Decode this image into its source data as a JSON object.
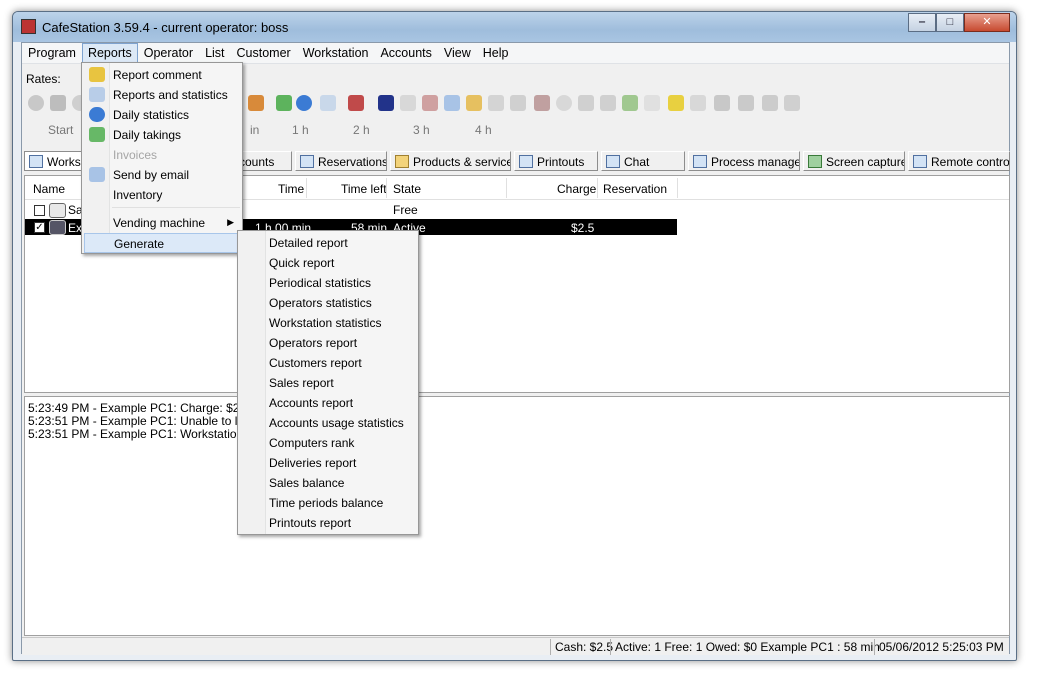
{
  "window": {
    "title": "CafeStation 3.59.4 - current operator: boss"
  },
  "menubar": [
    "Program",
    "Reports",
    "Operator",
    "List",
    "Customer",
    "Workstation",
    "Accounts",
    "View",
    "Help"
  ],
  "rates_label": "Rates:",
  "timebar": {
    "start": "Start",
    "marks": [
      "in",
      "1 h",
      "2 h",
      "3 h",
      "4 h"
    ]
  },
  "tabs": [
    {
      "label": "Works",
      "icon": "workstation-icon"
    },
    {
      "label": "ccounts",
      "icon": "accounts-icon"
    },
    {
      "label": "Reservations",
      "icon": "reservations-icon"
    },
    {
      "label": "Products & services",
      "icon": "products-icon"
    },
    {
      "label": "Printouts",
      "icon": "printer-icon"
    },
    {
      "label": "Chat",
      "icon": "chat-icon"
    },
    {
      "label": "Process manager",
      "icon": "process-icon"
    },
    {
      "label": "Screen capture",
      "icon": "screen-capture-icon"
    },
    {
      "label": "Remote control",
      "icon": "remote-control-icon"
    }
  ],
  "grid": {
    "headers": {
      "name": "Name",
      "time": "Time",
      "time_left": "Time left",
      "state": "State",
      "charge": "Charge",
      "reservation": "Reservation"
    },
    "rows": [
      {
        "name": "Sa",
        "time": "",
        "time_left": "",
        "state": "Free",
        "charge": "",
        "checked": false
      },
      {
        "name": "Exa",
        "time": "1 h 00 min",
        "time_left": "58 min",
        "state": "Active",
        "charge": "$2.5",
        "checked": true
      }
    ]
  },
  "log": [
    "5:23:49 PM - Example PC1: Charge: $2.5",
    "5:23:51 PM - Example PC1: Unable to lookup",
    "5:23:51 PM - Example PC1: Workstation was"
  ],
  "status": {
    "cash": "Cash: $2.5",
    "summary": "Active: 1 Free: 1 Owed: $0 Example PC1 : 58 min",
    "datetime": "05/06/2012 5:25:03 PM"
  },
  "reports_menu": [
    {
      "label": "Report comment",
      "icon": "comment-icon",
      "disabled": false
    },
    {
      "label": "Reports and statistics",
      "icon": "statistics-icon",
      "disabled": false
    },
    {
      "label": "Daily statistics",
      "icon": "pie-chart-icon",
      "disabled": false
    },
    {
      "label": "Daily takings",
      "icon": "money-icon",
      "disabled": false
    },
    {
      "label": "Invoices",
      "icon": "",
      "disabled": true
    },
    {
      "label": "Send by email",
      "icon": "email-icon",
      "disabled": false
    },
    {
      "label": "Inventory",
      "icon": "",
      "disabled": false
    },
    {
      "label": "Vending machine",
      "icon": "",
      "disabled": false,
      "submenu": true
    },
    {
      "label": "Generate",
      "icon": "",
      "disabled": false,
      "hover": true
    }
  ],
  "generate_menu": [
    "Detailed report",
    "Quick report",
    "Periodical statistics",
    "Operators statistics",
    "Workstation statistics",
    "Operators report",
    "Customers report",
    "Sales report",
    "Accounts report",
    "Accounts usage statistics",
    "Computers rank",
    "Deliveries report",
    "Sales balance",
    "Time periods balance",
    "Printouts report"
  ],
  "colors": {
    "selection": "#000000",
    "menu_hover": "#dce9f8",
    "accent": "#7fa3cf"
  }
}
